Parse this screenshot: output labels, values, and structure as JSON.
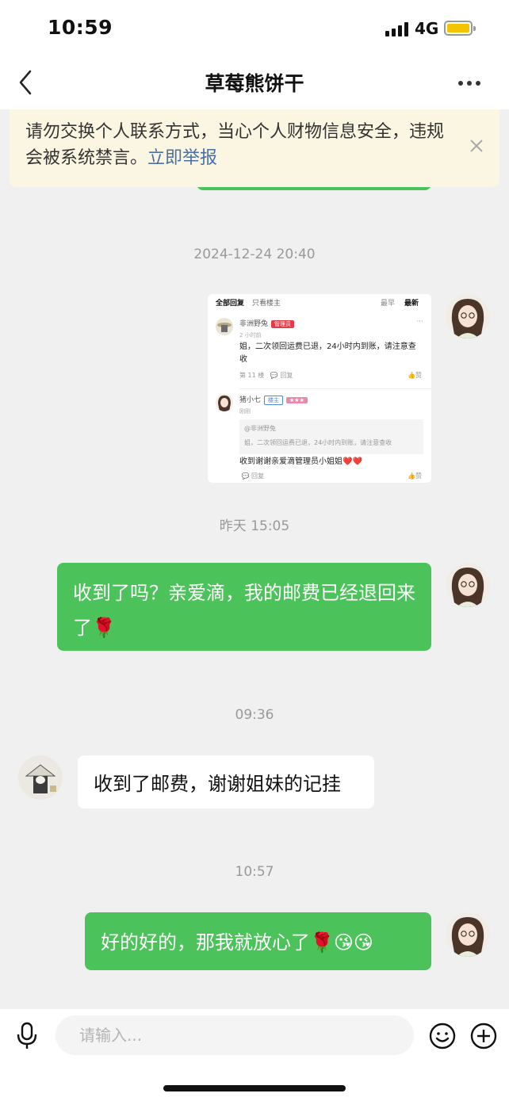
{
  "status_bar": {
    "time": "10:59",
    "network": "4G",
    "battery_color": "#f5c400"
  },
  "nav": {
    "title": "草莓熊饼干"
  },
  "notice": {
    "text": "请勿交换个人联系方式，当心个人财物信息安全，违规会被系统禁言。",
    "link": "立即举报"
  },
  "messages": {
    "ts1": "2024-12-24 20:40",
    "image_message": {
      "tab_all": "全部回复",
      "tab_host": "只看楼主",
      "sort_early": "最早",
      "sort_new": "最新",
      "c1_user": "非洲野兔",
      "c1_badge": "管理员",
      "c1_time": "2 小时前",
      "c1_text": "姐，二次领回运费已退，24小时内到账，请注意查收",
      "c1_floor": "第 11 楼",
      "c1_reply": "回复",
      "c1_like": "赞",
      "c2_user": "猪小七",
      "c2_badge": "楼主",
      "c2_stars": "★★★",
      "c2_time": "刚刚",
      "c2_quote_user": "@非洲野兔",
      "c2_quote_text": "姐，二次领回运费已退，24小时内到账，请注意查收",
      "c2_text": "收到谢谢亲爱滴管理员小姐姐❤️❤️",
      "c2_reply": "回复",
      "c2_like": "赞"
    },
    "ts2": "昨天 15:05",
    "msg1": "收到了吗？亲爱滴，我的邮费已经退回来了🌹",
    "ts3": "09:36",
    "msg2": "收到了邮费，谢谢姐妹的记挂",
    "ts4": "10:57",
    "msg3": "好的好的，那我就放心了🌹😘😘"
  },
  "input": {
    "placeholder": "请输入..."
  },
  "colors": {
    "accent_green": "#4cc35a",
    "notice_bg": "#faf6e1",
    "link_blue": "#4a6fa5"
  }
}
